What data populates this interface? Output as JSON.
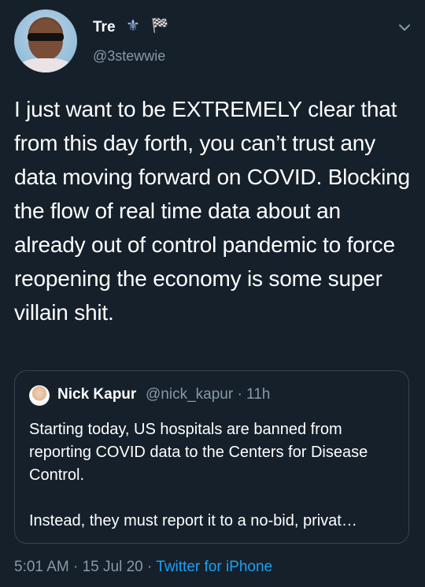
{
  "author": {
    "display_name": "Tre",
    "name_emoji": "⚜",
    "name_flag": "🏁",
    "handle": "@3stewwie"
  },
  "tweet": {
    "text": "I just want to be EXTREMELY clear that from this day forth, you can’t trust any data moving forward on COVID. Blocking the flow of real time data about an already out of control pandemic to force reopening the economy is some super villain shit."
  },
  "quoted_tweet": {
    "display_name": "Nick Kapur",
    "handle_time": "@nick_kapur · 11h",
    "paragraph1": "Starting today, US hospitals are banned from reporting COVID data to the Centers for Disease Control.",
    "paragraph2": "Instead, they must report it to a no-bid, privat…"
  },
  "meta": {
    "time": "5:01 AM",
    "separator1": " · ",
    "date": "15 Jul 20",
    "separator2": " · ",
    "source": "Twitter for iPhone"
  },
  "icons": {
    "menu": "chevron-down-icon"
  },
  "colors": {
    "background": "#15202b",
    "secondary_text": "#8899a6",
    "link": "#1da1f2",
    "border": "#38444d"
  }
}
